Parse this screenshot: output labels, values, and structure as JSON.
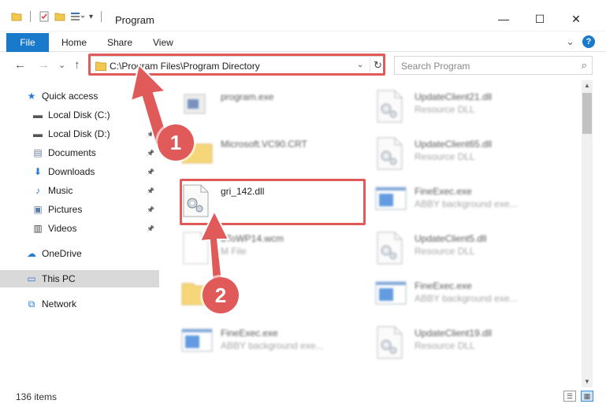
{
  "window": {
    "title": "Program",
    "minimize": "—",
    "maximize": "☐",
    "close": "✕"
  },
  "ribbon": {
    "tabs": [
      "File",
      "Home",
      "Share",
      "View"
    ],
    "expand": "⌄",
    "help": "?"
  },
  "navigation": {
    "back": "←",
    "forward": "→",
    "recent": "⌄",
    "up": "↑",
    "address": "C:\\Program Files\\Program Directory",
    "dropdown": "⌄",
    "refresh": "↻",
    "search_placeholder": "Search Program"
  },
  "sidebar": {
    "items": [
      {
        "label": "Quick access",
        "icon": "star-icon",
        "pinned": false
      },
      {
        "label": "Local Disk (C:)",
        "icon": "drive-icon",
        "pinned": true
      },
      {
        "label": "Local Disk (D:)",
        "icon": "drive-icon",
        "pinned": true
      },
      {
        "label": "Documents",
        "icon": "documents-icon",
        "pinned": true
      },
      {
        "label": "Downloads",
        "icon": "download-icon",
        "pinned": true
      },
      {
        "label": "Music",
        "icon": "music-icon",
        "pinned": true
      },
      {
        "label": "Pictures",
        "icon": "pictures-icon",
        "pinned": true
      },
      {
        "label": "Videos",
        "icon": "videos-icon",
        "pinned": true
      },
      {
        "label": "OneDrive",
        "icon": "cloud-icon",
        "pinned": false
      },
      {
        "label": "This PC",
        "icon": "computer-icon",
        "pinned": false,
        "selected": true
      },
      {
        "label": "Network",
        "icon": "network-icon",
        "pinned": false
      }
    ]
  },
  "files": [
    {
      "name": "program.exe",
      "desc": "",
      "icon": "exe-icon",
      "blurred": true
    },
    {
      "name": "UpdateClient21.dll",
      "desc": "Resource DLL",
      "icon": "dll-icon",
      "blurred": true
    },
    {
      "name": "Microsoft.VC90.CRT",
      "desc": "",
      "icon": "folder-icon",
      "blurred": true
    },
    {
      "name": "UpdateClient65.dll",
      "desc": "Resource DLL",
      "icon": "dll-icon",
      "blurred": true
    },
    {
      "name": "gri_142.dll",
      "desc": "",
      "icon": "dll-icon",
      "blurred": false
    },
    {
      "name": "FineExec.exe",
      "desc": "ABBY background exe...",
      "icon": "window-icon",
      "blurred": true
    },
    {
      "name": "dToWP14.wcm",
      "desc": "M File",
      "icon": "file-icon",
      "blurred": true
    },
    {
      "name": "UpdateClient5.dll",
      "desc": "Resource DLL",
      "icon": "dll-icon",
      "blurred": true
    },
    {
      "name": "",
      "desc": "",
      "icon": "folder-icon",
      "blurred": true
    },
    {
      "name": "FineExec.exe",
      "desc": "ABBY background exe...",
      "icon": "window-icon",
      "blurred": true
    },
    {
      "name": "FineExec.exe",
      "desc": "ABBY background exe...",
      "icon": "window-icon",
      "blurred": true
    },
    {
      "name": "UpdateClient19.dll",
      "desc": "Resource DLL",
      "icon": "dll-icon",
      "blurred": true
    }
  ],
  "status": {
    "item_count": "136 items"
  },
  "callouts": [
    "1",
    "2"
  ],
  "colors": {
    "accent": "#1979ca",
    "highlight_red": "#e05a5a",
    "selected_bg": "#d9d9d9"
  }
}
